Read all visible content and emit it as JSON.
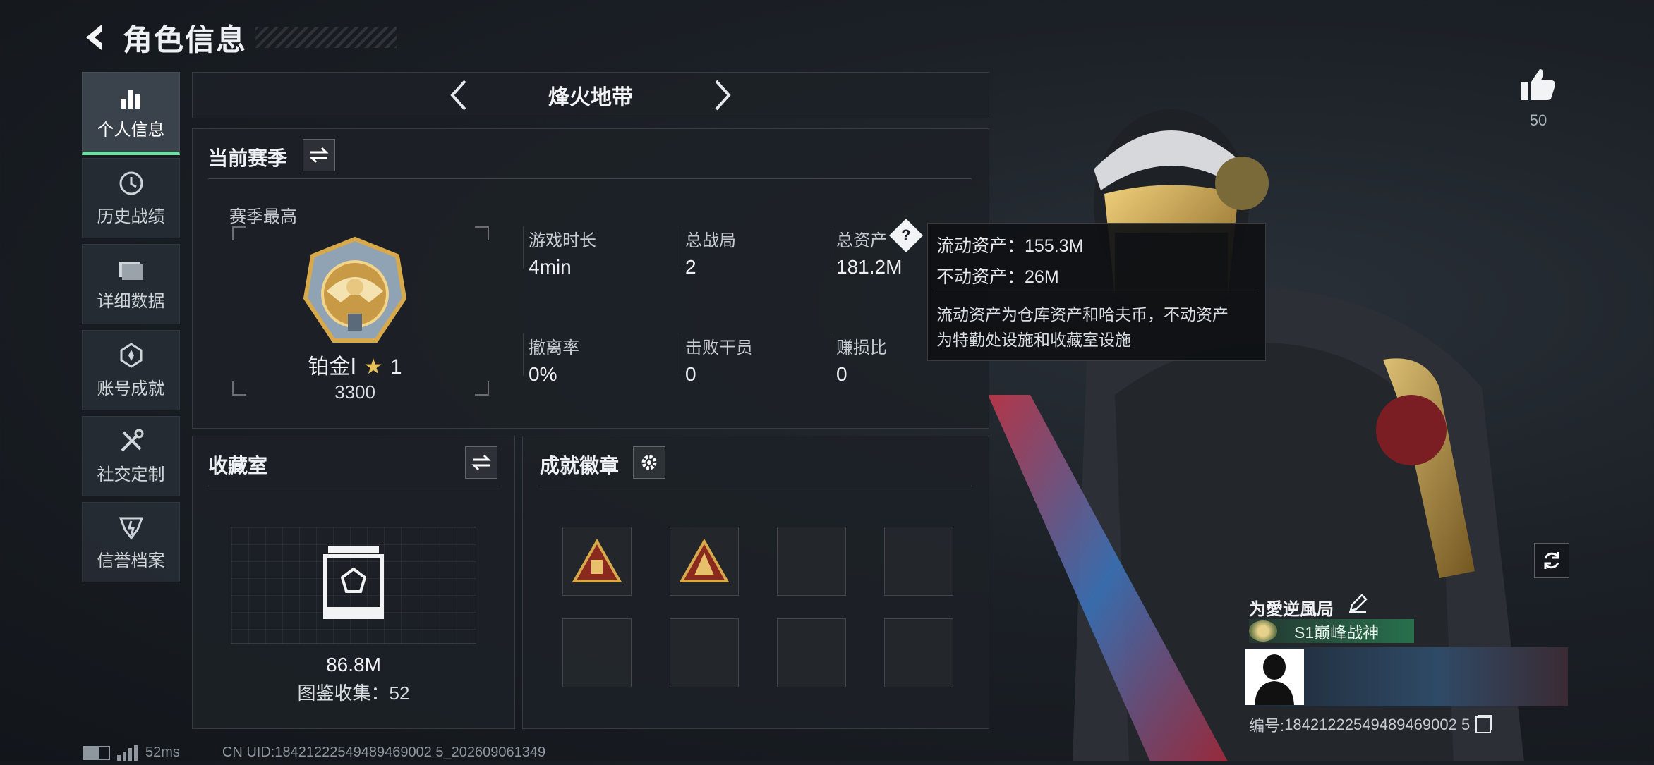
{
  "header": {
    "title": "角色信息"
  },
  "sidebar": {
    "items": [
      {
        "label": "个人信息",
        "icon": "bar-chart-icon",
        "active": true
      },
      {
        "label": "历史战绩",
        "icon": "history-icon"
      },
      {
        "label": "详细数据",
        "icon": "folder-icon"
      },
      {
        "label": "账号成就",
        "icon": "achievement-icon"
      },
      {
        "label": "社交定制",
        "icon": "tools-icon"
      },
      {
        "label": "信誉档案",
        "icon": "credit-icon"
      }
    ]
  },
  "mode_selector": {
    "current": "烽火地带"
  },
  "season": {
    "title": "当前赛季",
    "best_label": "赛季最高",
    "rank_name": "铂金Ⅰ",
    "rank_stars": "1",
    "rank_score": "3300",
    "stats": [
      {
        "label": "游戏时长",
        "value": "4min"
      },
      {
        "label": "总战局",
        "value": "2"
      },
      {
        "label": "总资产",
        "value": "181.2M",
        "has_help": true
      },
      {
        "label": "撤离率",
        "value": "0%"
      },
      {
        "label": "击败干员",
        "value": "0"
      },
      {
        "label": "赚损比",
        "value": "0"
      }
    ]
  },
  "tooltip": {
    "liquid_label": "流动资产：",
    "liquid_value": "155.3M",
    "fixed_label": "不动资产：",
    "fixed_value": "26M",
    "desc_line1": "流动资产为仓库资产和哈夫币，不动资产",
    "desc_line2": "为特勤处设施和收藏室设施"
  },
  "collection": {
    "title": "收藏室",
    "value": "86.8M",
    "catalog_label": "图鉴收集：",
    "catalog_count": "52"
  },
  "badges": {
    "title": "成就徽章",
    "slots": [
      "triangle-badge-1",
      "triangle-badge-2",
      "",
      "",
      "",
      "",
      "",
      ""
    ]
  },
  "like": {
    "count": "50"
  },
  "player": {
    "name": "为愛逆風局",
    "title_badge": "S1巅峰战神",
    "id_label": "编号:",
    "id_value": "18421222549489469002 5"
  },
  "status_bar": {
    "ping": "52ms",
    "uid": "CN UID:18421222549489469002 5_202609061349"
  },
  "colors": {
    "accent_green": "#6ee0a3",
    "gold": "#d7a94a"
  }
}
